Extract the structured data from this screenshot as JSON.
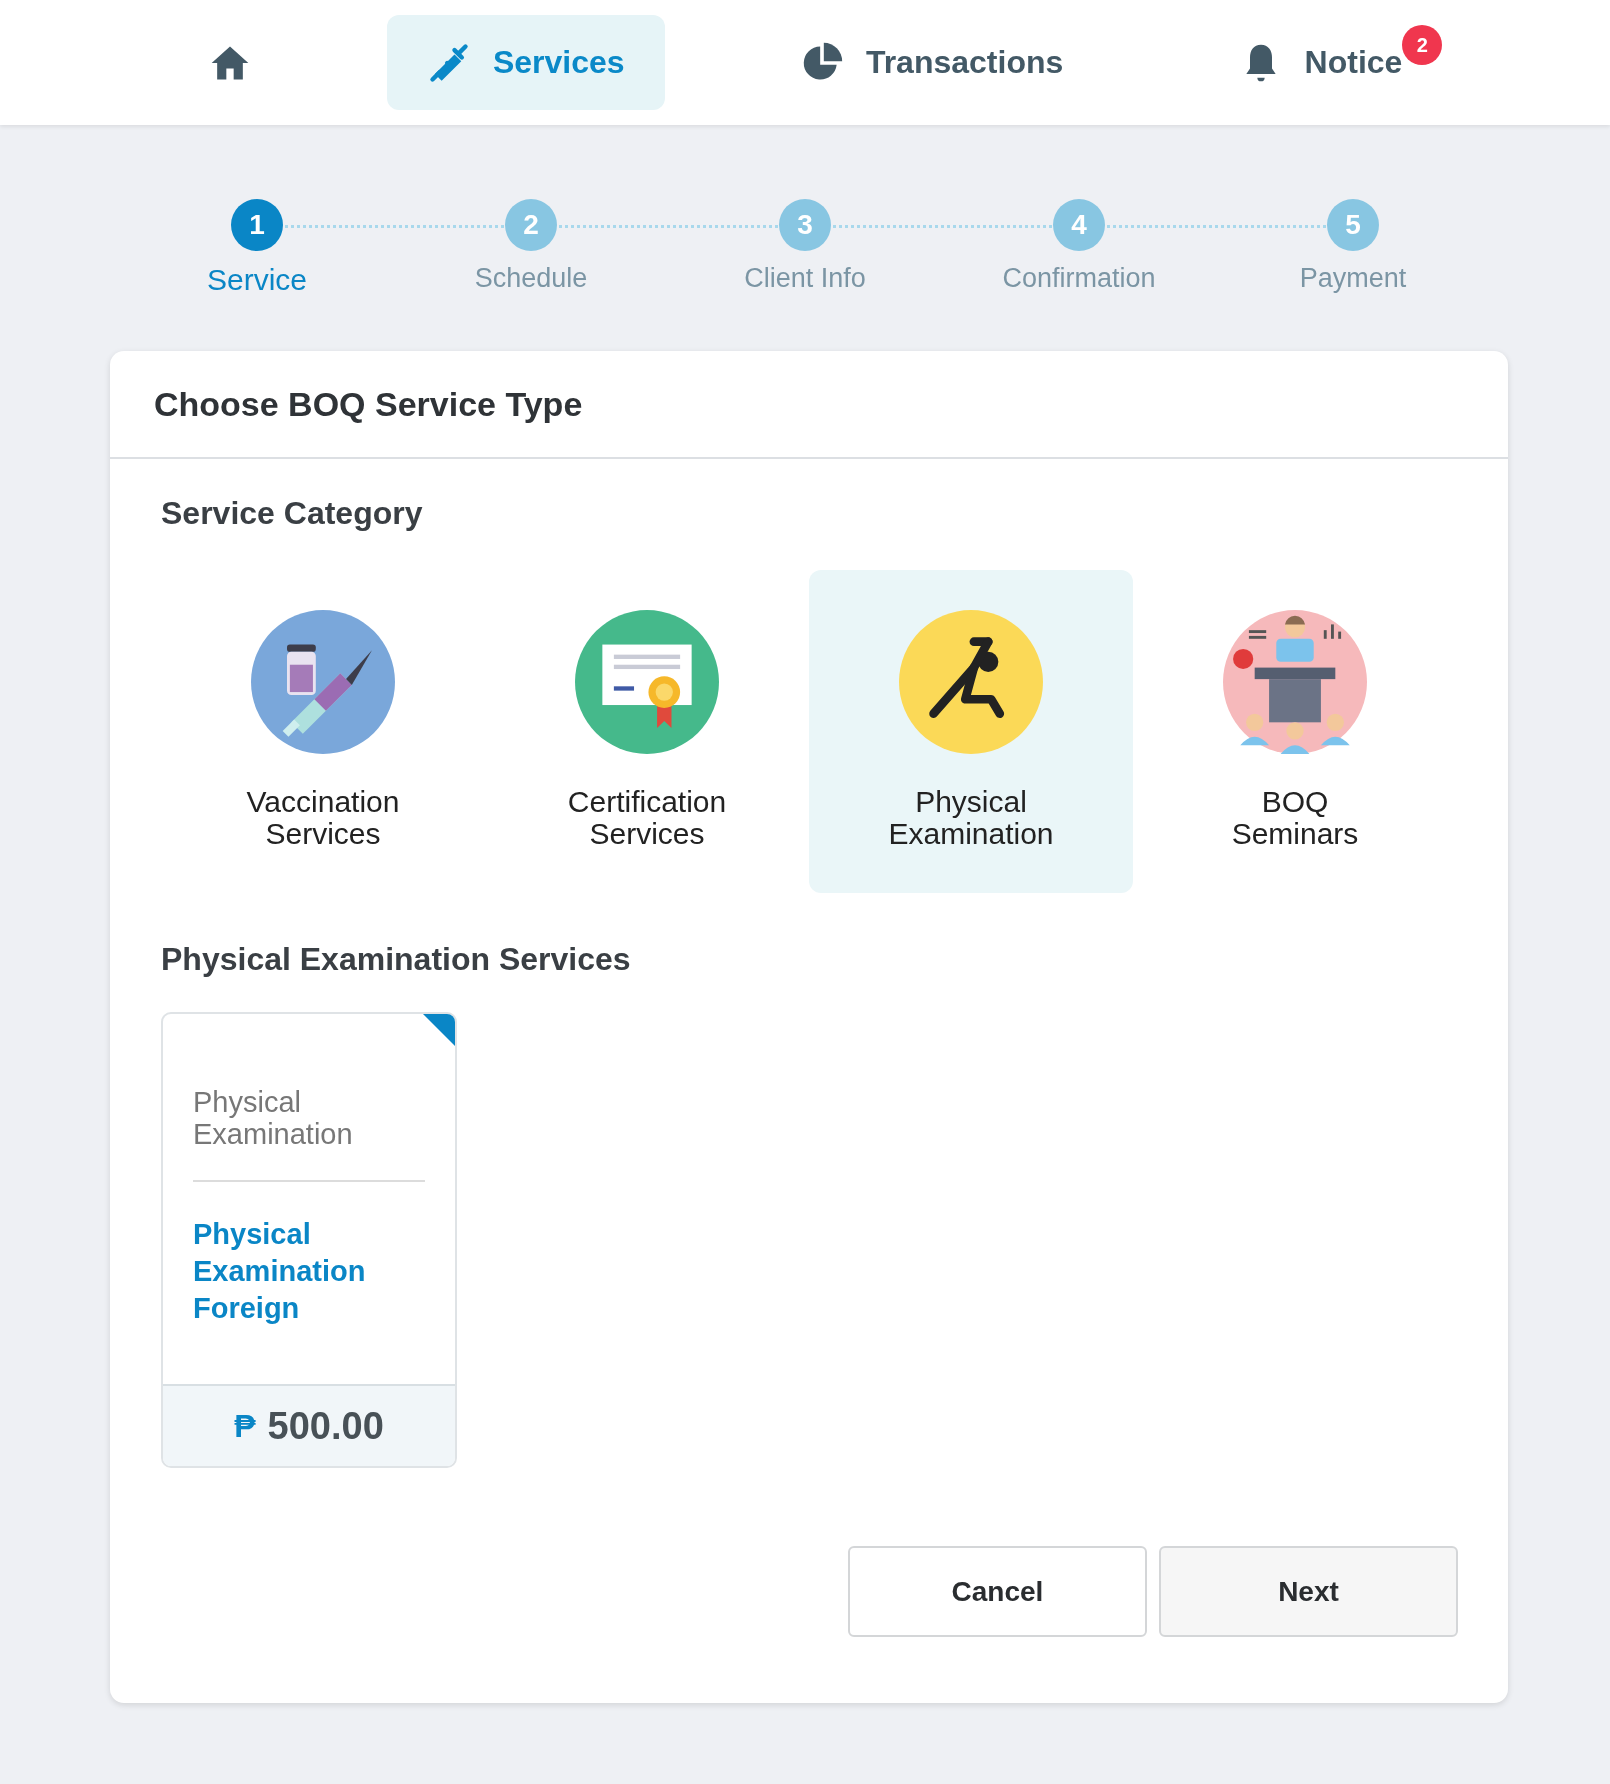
{
  "nav": [
    {
      "kind": "home",
      "selected": false
    },
    {
      "kind": "services",
      "label": "Services",
      "selected": true
    },
    {
      "kind": "transactions",
      "label": "Transactions",
      "selected": false
    },
    {
      "kind": "notice",
      "label": "Notice",
      "badge": "2",
      "selected": false
    }
  ],
  "steps": [
    {
      "number": "1",
      "label": "Service",
      "selected": true
    },
    {
      "number": "2",
      "label": "Schedule",
      "selected": false
    },
    {
      "number": "3",
      "label": "Client Info",
      "selected": false
    },
    {
      "number": "4",
      "label": "Confirmation",
      "selected": false
    },
    {
      "number": "5",
      "label": "Payment",
      "selected": false
    }
  ],
  "panel": {
    "title": "Choose BOQ Service Type",
    "category_heading": "Service Category",
    "categories": [
      {
        "kind": "vaccination",
        "label": "Vaccination Services",
        "selected": false
      },
      {
        "kind": "certification",
        "label": "Certification Services",
        "selected": false
      },
      {
        "kind": "exercise",
        "label": "Physical Examination",
        "selected": true
      },
      {
        "kind": "seminar",
        "label": "BOQ Seminars",
        "selected": false
      }
    ],
    "services_heading": "Physical Examination Services",
    "services": [
      {
        "category": "Physical Examination",
        "name": "Physical Examination Foreign",
        "currency": "₱",
        "price": "500.00",
        "selected": true
      }
    ],
    "buttons": [
      "Cancel",
      "Next"
    ]
  }
}
